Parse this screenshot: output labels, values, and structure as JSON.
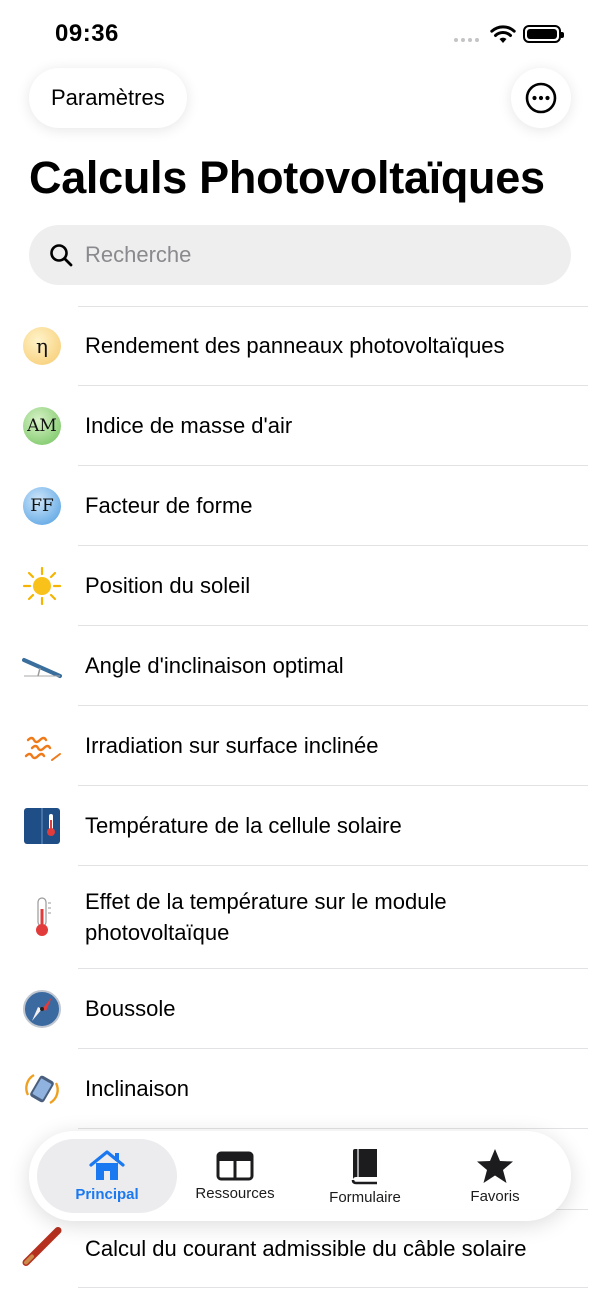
{
  "status": {
    "time": "09:36"
  },
  "nav": {
    "settings_label": "Paramètres",
    "more_icon": "ellipsis-circle-icon"
  },
  "page": {
    "title": "Calculs Photovoltaïques"
  },
  "search": {
    "placeholder": "Recherche"
  },
  "list": {
    "items": [
      {
        "label": "Rendement des panneaux photovoltaïques",
        "icon": "eta-icon",
        "icon_text": "η"
      },
      {
        "label": "Indice de masse d'air",
        "icon": "air-mass-icon",
        "icon_text": "AM"
      },
      {
        "label": "Facteur de forme",
        "icon": "fill-factor-icon",
        "icon_text": "FF"
      },
      {
        "label": "Position du soleil",
        "icon": "sun-icon"
      },
      {
        "label": "Angle d'inclinaison optimal",
        "icon": "tilt-angle-icon"
      },
      {
        "label": "Irradiation sur surface inclinée",
        "icon": "irradiation-icon"
      },
      {
        "label": "Température de la cellule solaire",
        "icon": "solar-cell-thermometer-icon"
      },
      {
        "label": "Effet de la température sur le module photovoltaïque",
        "icon": "thermometer-icon"
      },
      {
        "label": "Boussole",
        "icon": "compass-icon"
      },
      {
        "label": "Inclinaison",
        "icon": "phone-tilt-icon"
      },
      {
        "label": "Calcul du courant admissible du câble solaire",
        "icon": "solar-cable-icon"
      }
    ]
  },
  "tabs": [
    {
      "label": "Principal",
      "icon": "house-icon",
      "active": true
    },
    {
      "label": "Ressources",
      "icon": "table-icon",
      "active": false
    },
    {
      "label": "Formulaire",
      "icon": "book-icon",
      "active": false
    },
    {
      "label": "Favoris",
      "icon": "star-icon",
      "active": false
    }
  ],
  "colors": {
    "accent": "#1a78f0",
    "separator": "#e2e2e4"
  }
}
